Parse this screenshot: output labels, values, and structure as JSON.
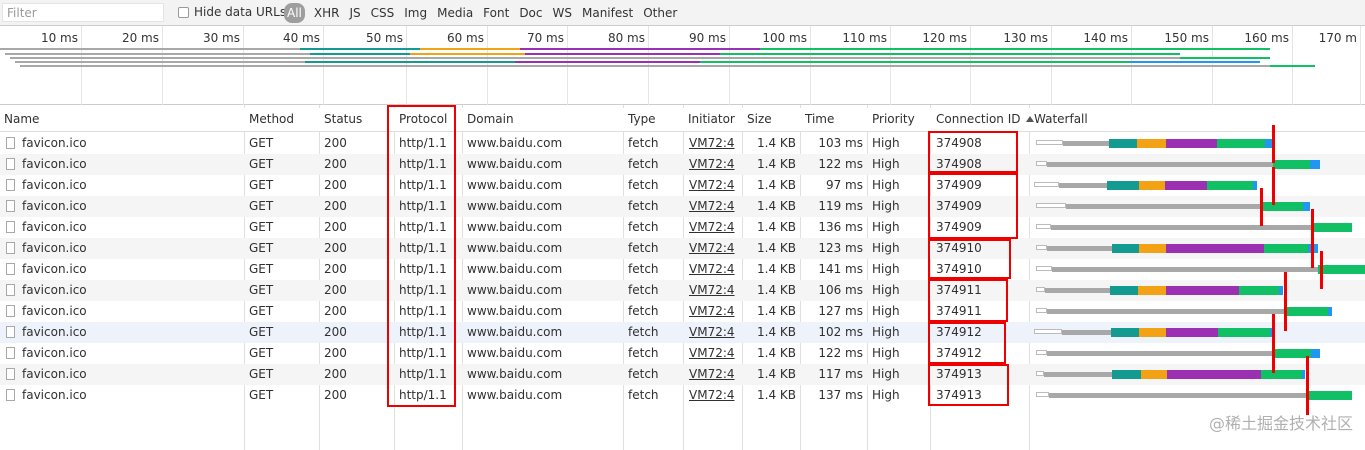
{
  "filter_bar": {
    "placeholder": "Filter",
    "hide_data_urls": "Hide data URLs",
    "types": [
      "All",
      "XHR",
      "JS",
      "CSS",
      "Img",
      "Media",
      "Font",
      "Doc",
      "WS",
      "Manifest",
      "Other"
    ]
  },
  "overview": {
    "ticks": [
      "10 ms",
      "20 ms",
      "30 ms",
      "40 ms",
      "50 ms",
      "60 ms",
      "70 ms",
      "80 ms",
      "90 ms",
      "100 ms",
      "110 ms",
      "120 ms",
      "130 ms",
      "140 ms",
      "150 ms",
      "160 ms",
      "170 m"
    ]
  },
  "columns": {
    "name": "Name",
    "method": "Method",
    "status": "Status",
    "protocol": "Protocol",
    "domain": "Domain",
    "type": "Type",
    "initiator": "Initiator",
    "size": "Size",
    "time": "Time",
    "priority": "Priority",
    "connection_id": "Connection ID",
    "waterfall": "Waterfall"
  },
  "sort_icon": "triangle-up",
  "rows": [
    {
      "name": "favicon.ico",
      "method": "GET",
      "status": "200",
      "protocol": "http/1.1",
      "domain": "www.baidu.com",
      "type": "fetch",
      "initiator": "VM72:4",
      "size": "1.4 KB",
      "time": "103 ms",
      "priority": "High",
      "connection_id": "374908"
    },
    {
      "name": "favicon.ico",
      "method": "GET",
      "status": "200",
      "protocol": "http/1.1",
      "domain": "www.baidu.com",
      "type": "fetch",
      "initiator": "VM72:4",
      "size": "1.4 KB",
      "time": "122 ms",
      "priority": "High",
      "connection_id": "374908"
    },
    {
      "name": "favicon.ico",
      "method": "GET",
      "status": "200",
      "protocol": "http/1.1",
      "domain": "www.baidu.com",
      "type": "fetch",
      "initiator": "VM72:4",
      "size": "1.4 KB",
      "time": "97 ms",
      "priority": "High",
      "connection_id": "374909"
    },
    {
      "name": "favicon.ico",
      "method": "GET",
      "status": "200",
      "protocol": "http/1.1",
      "domain": "www.baidu.com",
      "type": "fetch",
      "initiator": "VM72:4",
      "size": "1.4 KB",
      "time": "119 ms",
      "priority": "High",
      "connection_id": "374909"
    },
    {
      "name": "favicon.ico",
      "method": "GET",
      "status": "200",
      "protocol": "http/1.1",
      "domain": "www.baidu.com",
      "type": "fetch",
      "initiator": "VM72:4",
      "size": "1.4 KB",
      "time": "136 ms",
      "priority": "High",
      "connection_id": "374909"
    },
    {
      "name": "favicon.ico",
      "method": "GET",
      "status": "200",
      "protocol": "http/1.1",
      "domain": "www.baidu.com",
      "type": "fetch",
      "initiator": "VM72:4",
      "size": "1.4 KB",
      "time": "123 ms",
      "priority": "High",
      "connection_id": "374910"
    },
    {
      "name": "favicon.ico",
      "method": "GET",
      "status": "200",
      "protocol": "http/1.1",
      "domain": "www.baidu.com",
      "type": "fetch",
      "initiator": "VM72:4",
      "size": "1.4 KB",
      "time": "141 ms",
      "priority": "High",
      "connection_id": "374910"
    },
    {
      "name": "favicon.ico",
      "method": "GET",
      "status": "200",
      "protocol": "http/1.1",
      "domain": "www.baidu.com",
      "type": "fetch",
      "initiator": "VM72:4",
      "size": "1.4 KB",
      "time": "106 ms",
      "priority": "High",
      "connection_id": "374911"
    },
    {
      "name": "favicon.ico",
      "method": "GET",
      "status": "200",
      "protocol": "http/1.1",
      "domain": "www.baidu.com",
      "type": "fetch",
      "initiator": "VM72:4",
      "size": "1.4 KB",
      "time": "127 ms",
      "priority": "High",
      "connection_id": "374911"
    },
    {
      "name": "favicon.ico",
      "method": "GET",
      "status": "200",
      "protocol": "http/1.1",
      "domain": "www.baidu.com",
      "type": "fetch",
      "initiator": "VM72:4",
      "size": "1.4 KB",
      "time": "102 ms",
      "priority": "High",
      "connection_id": "374912"
    },
    {
      "name": "favicon.ico",
      "method": "GET",
      "status": "200",
      "protocol": "http/1.1",
      "domain": "www.baidu.com",
      "type": "fetch",
      "initiator": "VM72:4",
      "size": "1.4 KB",
      "time": "122 ms",
      "priority": "High",
      "connection_id": "374912"
    },
    {
      "name": "favicon.ico",
      "method": "GET",
      "status": "200",
      "protocol": "http/1.1",
      "domain": "www.baidu.com",
      "type": "fetch",
      "initiator": "VM72:4",
      "size": "1.4 KB",
      "time": "117 ms",
      "priority": "High",
      "connection_id": "374913"
    },
    {
      "name": "favicon.ico",
      "method": "GET",
      "status": "200",
      "protocol": "http/1.1",
      "domain": "www.baidu.com",
      "type": "fetch",
      "initiator": "VM72:4",
      "size": "1.4 KB",
      "time": "137 ms",
      "priority": "High",
      "connection_id": "374913"
    }
  ],
  "colors": {
    "queued": "#ffffff",
    "stalled": "#a8a8a8",
    "dns": "#139b92",
    "connect": "#f4a215",
    "ssl": "#9c30b3",
    "waiting": "#11c064",
    "download": "#2196f3",
    "highlight": "#e00000"
  },
  "watermark": "@稀土掘金技术社区"
}
